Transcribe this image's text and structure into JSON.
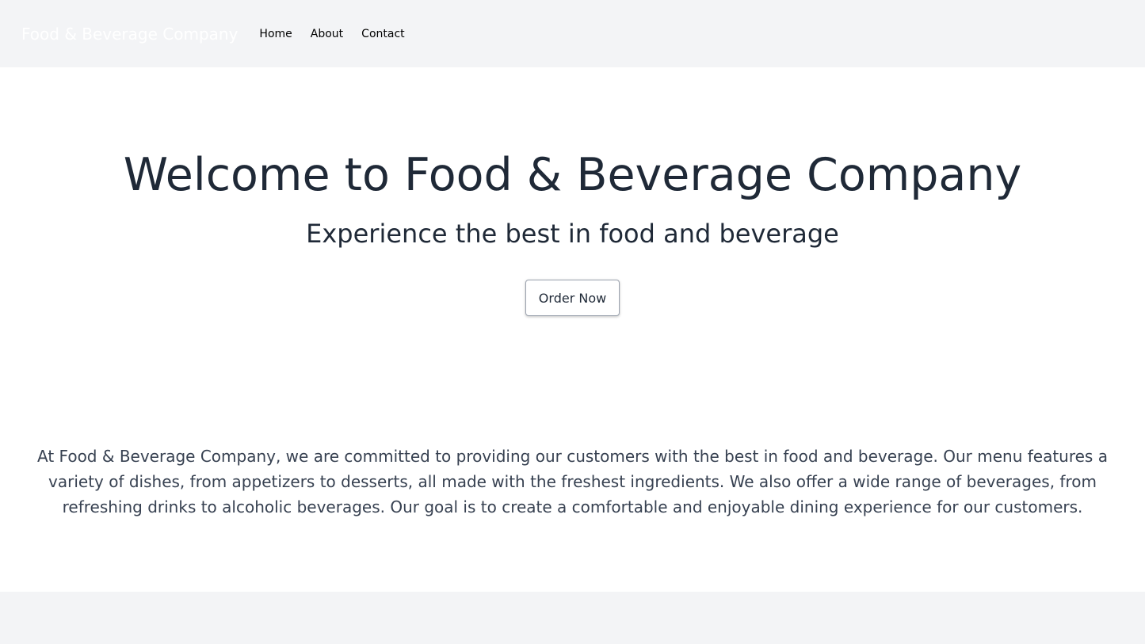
{
  "nav": {
    "brand": "Food & Beverage Company",
    "links": [
      "Home",
      "About",
      "Contact"
    ]
  },
  "hero": {
    "title": "Welcome to Food & Beverage Company",
    "subtitle": "Experience the best in food and beverage",
    "button_label": "Order Now"
  },
  "about": {
    "text": "At Food & Beverage Company, we are committed to providing our customers with the best in food and beverage. Our menu features a variety of dishes, from appetizers to desserts, all made with the freshest ingredients. We also offer a wide range of beverages, from refreshing drinks to alcoholic beverages. Our goal is to create a comfortable and enjoyable dining experience for our customers."
  },
  "colors": {
    "nav_background": "#f3f4f6",
    "brand_text": "#ffffff",
    "heading_text": "#1f2937",
    "body_text": "#374151",
    "footer_background": "#f3f4f6"
  }
}
